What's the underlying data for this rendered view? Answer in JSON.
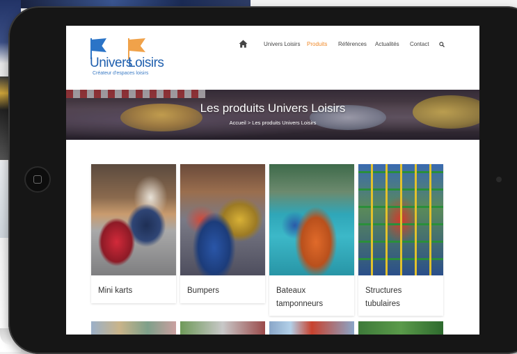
{
  "site": {
    "logo": {
      "word1": "Univers",
      "word2": "Loisirs",
      "tagline": "Créateur d'espaces loisirs"
    },
    "nav": {
      "home_icon": "home-icon",
      "items": [
        {
          "label": "Univers Loisirs",
          "active": false
        },
        {
          "label": "Produits",
          "active": true
        },
        {
          "label": "Références",
          "active": false
        },
        {
          "label": "Actualités",
          "active": false
        },
        {
          "label": "Contact",
          "active": false
        }
      ],
      "search_icon": "search-icon"
    },
    "banner": {
      "title": "Les produits Univers Loisirs",
      "breadcrumb": "Accueil > Les produits Univers Loisirs"
    },
    "products": [
      {
        "label": "Mini karts"
      },
      {
        "label": "Bumpers"
      },
      {
        "label": "Bateaux tamponneurs"
      },
      {
        "label": "Structures tubulaires"
      }
    ]
  },
  "colors": {
    "accent": "#f08a2a",
    "logo_blue": "#1f5fae",
    "logo_orange": "#f0a24a"
  }
}
